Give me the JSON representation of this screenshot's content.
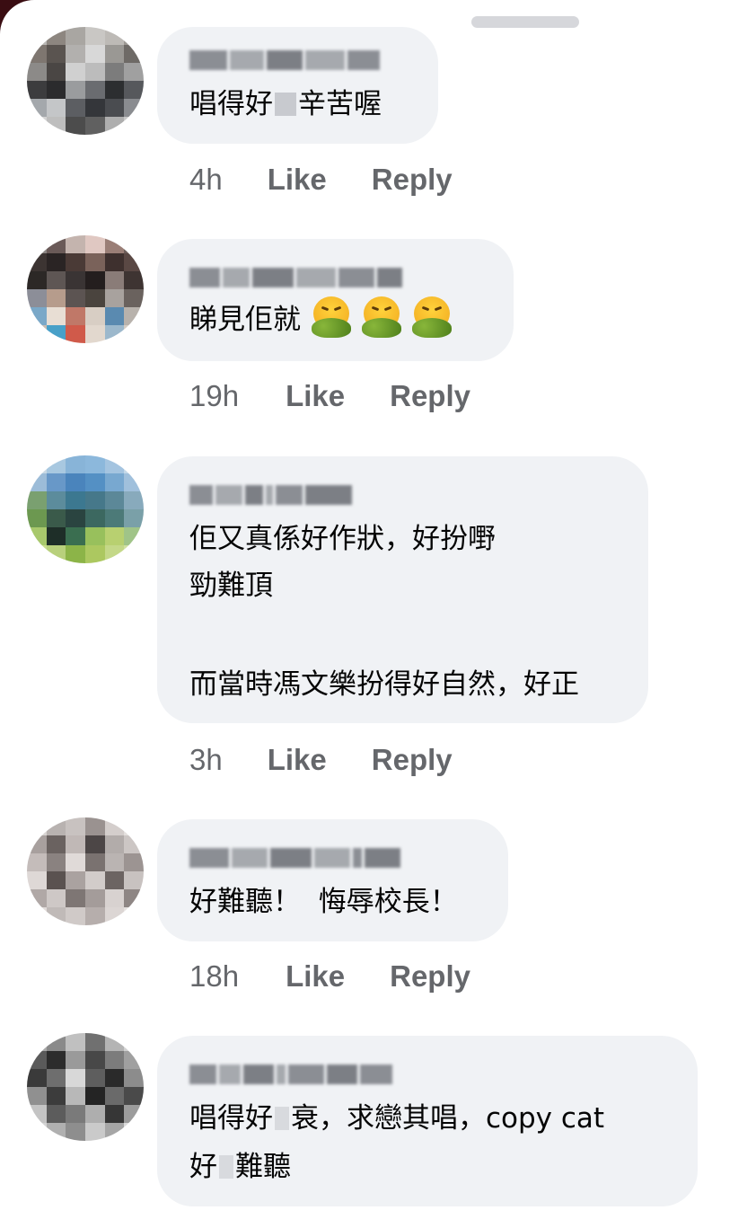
{
  "comments": [
    {
      "time": "4h",
      "like_label": "Like",
      "reply_label": "Reply",
      "lines": [
        {
          "parts": [
            "唱得好",
            "辛苦喔"
          ],
          "censored": true
        }
      ]
    },
    {
      "time": "19h",
      "like_label": "Like",
      "reply_label": "Reply",
      "lines": [
        {
          "text": "睇見佢就",
          "emoji": [
            "nauseated-face-icon",
            "nauseated-face-icon",
            "nauseated-face-icon"
          ]
        }
      ]
    },
    {
      "time": "3h",
      "like_label": "Like",
      "reply_label": "Reply",
      "lines": [
        {
          "text": "佢又真係好作狀，好扮嘢"
        },
        {
          "text": "勁難頂"
        },
        {
          "text": "而當時馮文樂扮得好自然，好正"
        }
      ]
    },
    {
      "time": "18h",
      "like_label": "Like",
      "reply_label": "Reply",
      "lines": [
        {
          "text": "好難聽！  悔辱校長！"
        }
      ]
    },
    {
      "time": "",
      "like_label": "",
      "reply_label": "",
      "lines": [
        {
          "parts": [
            "唱得好",
            "衰，求戀其唱，copy cat"
          ],
          "censored": true
        },
        {
          "parts": [
            "好",
            "難聽"
          ],
          "censored": true
        }
      ]
    }
  ],
  "colors": {
    "bubble": "#f0f2f5",
    "meta_text": "#65676b",
    "body_text": "#050505"
  }
}
